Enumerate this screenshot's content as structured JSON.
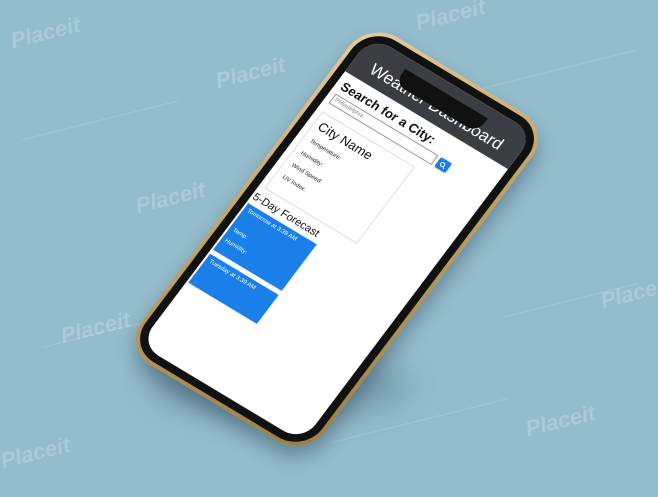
{
  "watermark_text": "Placeit",
  "app": {
    "title": "Weather Dashboard",
    "search_heading": "Search for a City:",
    "search_placeholder": "Philadelphia",
    "search_button_icon": "search-icon"
  },
  "current": {
    "city_name": "City Name",
    "temperature_label": "Temperature:",
    "humidity_label": "Humidity:",
    "wind_label": "Wind Speed:",
    "uv_label": "UV Index:"
  },
  "forecast": {
    "heading": "5-Day Forecast",
    "cards": [
      {
        "date": "Tomorrow at 3:39 AM",
        "temp_label": "Temp:",
        "humidity_label": "Humidity:"
      },
      {
        "date": "Tuesday at 3:39 AM"
      }
    ]
  },
  "colors": {
    "background": "#93bccd",
    "header": "#3a3d42",
    "accent": "#1a7fe8",
    "phone_gold": "#c4a467"
  }
}
